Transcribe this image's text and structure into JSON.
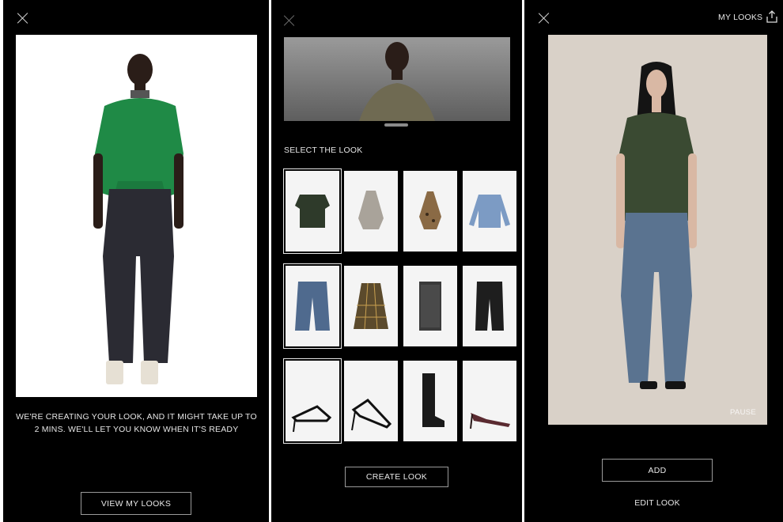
{
  "panel1": {
    "close_icon": "close-icon",
    "status_message": "WE'RE CREATING YOUR LOOK, AND IT MIGHT TAKE UP TO 2 MINS. WE'LL LET YOU KNOW WHEN IT'S READY",
    "view_looks_label": "VIEW MY LOOKS"
  },
  "panel2": {
    "close_icon": "close-icon",
    "section_title": "SELECT THE LOOK",
    "items": [
      {
        "name": "dark-green-top",
        "selected": true
      },
      {
        "name": "silver-halter-top",
        "selected": false
      },
      {
        "name": "leopard-halter-top",
        "selected": false
      },
      {
        "name": "blue-sweater",
        "selected": false
      },
      {
        "name": "blue-jeans",
        "selected": true
      },
      {
        "name": "plaid-skirt",
        "selected": false
      },
      {
        "name": "sequin-skirt",
        "selected": false
      },
      {
        "name": "black-cargo-pants",
        "selected": false
      },
      {
        "name": "strappy-sandals",
        "selected": true
      },
      {
        "name": "black-heeled-sandals",
        "selected": false
      },
      {
        "name": "black-boots",
        "selected": false
      },
      {
        "name": "burgundy-slingback-heels",
        "selected": false
      }
    ],
    "create_look_label": "CREATE LOOK"
  },
  "panel3": {
    "close_icon": "close-icon",
    "my_looks_label": "MY LOOKS",
    "share_icon": "share-icon",
    "pause_label": "PAUSE",
    "add_label": "ADD",
    "edit_look_label": "EDIT LOOK"
  }
}
